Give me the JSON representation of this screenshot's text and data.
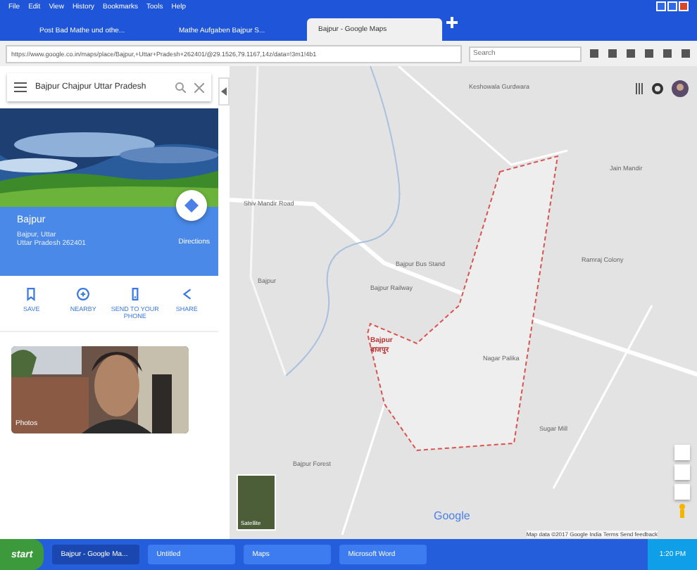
{
  "menu": [
    "File",
    "Edit",
    "View",
    "History",
    "Bookmarks",
    "Tools",
    "Help"
  ],
  "tabs": [
    {
      "title": "Post Bad Mathe und othe...",
      "selected": false
    },
    {
      "title": "Mathe Aufgaben Bajpur S...",
      "selected": false
    },
    {
      "title": "Bajpur - Google Maps",
      "selected": true
    }
  ],
  "address_bar": {
    "url": "https://www.google.co.in/maps/place/Bajpur,+Uttar+Pradesh+262401/@29.1526,79.1167,14z/data=!3m1!4b1",
    "search_placeholder": "Search"
  },
  "sidebar": {
    "search_value": "Bajpur Chajpur Uttar Pradesh",
    "place_name": "Bajpur",
    "place_lines": [
      "Bajpur, Uttar",
      "Uttar Pradesh 262401"
    ],
    "directions_label": "Directions",
    "actions": [
      {
        "label": "SAVE"
      },
      {
        "label": "NEARBY"
      },
      {
        "label": "SEND TO YOUR PHONE"
      },
      {
        "label": "SHARE"
      }
    ],
    "photo_caption": "Photos"
  },
  "map": {
    "labels": [
      "Keshowala Gurdwara",
      "Shiv Mandir Road",
      "Bajpur",
      "Bajpur Bus Stand",
      "Bajpur Railway",
      "Jain Mandir",
      "Ramraj Colony",
      "Nagar Palika",
      "Bajpur Forest",
      "Sugar Mill"
    ],
    "boundary_label": "Bajpur बाजपुर",
    "logo": "Google",
    "layer_label": "Satellite",
    "footer": "Map data ©2017 Google   India   Terms   Send feedback"
  },
  "taskbar": {
    "start": "start",
    "items": [
      {
        "title": "Bajpur - Google Ma...",
        "selected": true
      },
      {
        "title": "Untitled",
        "selected": false
      },
      {
        "title": "Maps",
        "selected": false
      },
      {
        "title": "Microsoft Word",
        "selected": false
      }
    ],
    "clock": "1:20 PM"
  }
}
